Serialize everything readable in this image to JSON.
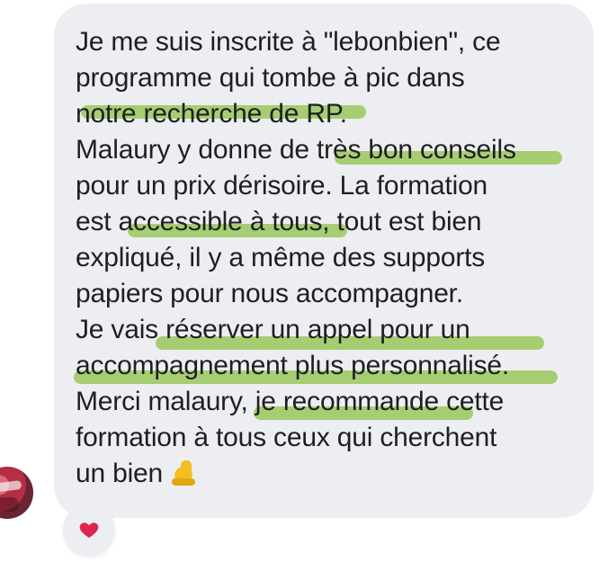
{
  "message": {
    "lines": [
      "Je me suis inscrite à \"lebonbien\", ce",
      "programme qui tombe à pic dans",
      "notre recherche de RP.",
      "Malaury y donne de très bon conseils",
      "pour un prix dérisoire. La formation",
      "est accessible à tous, tout est bien",
      "expliqué, il y a même des supports",
      "papiers pour nous accompagner.",
      "Je vais réserver un appel pour un",
      "accompagnement plus personnalisé.",
      "Merci malaury, je recommande cette",
      "formation à tous ceux qui cherchent",
      "un bien"
    ],
    "emoji_icon": "flexed-biceps-icon"
  },
  "reaction": {
    "icon": "red-heart-icon"
  },
  "avatar": {
    "icon": "user-avatar"
  },
  "colors": {
    "bubble_background": "#eceef2",
    "text": "#1f1f1f",
    "highlight": "#92c44e",
    "heart": "#e0244f"
  }
}
